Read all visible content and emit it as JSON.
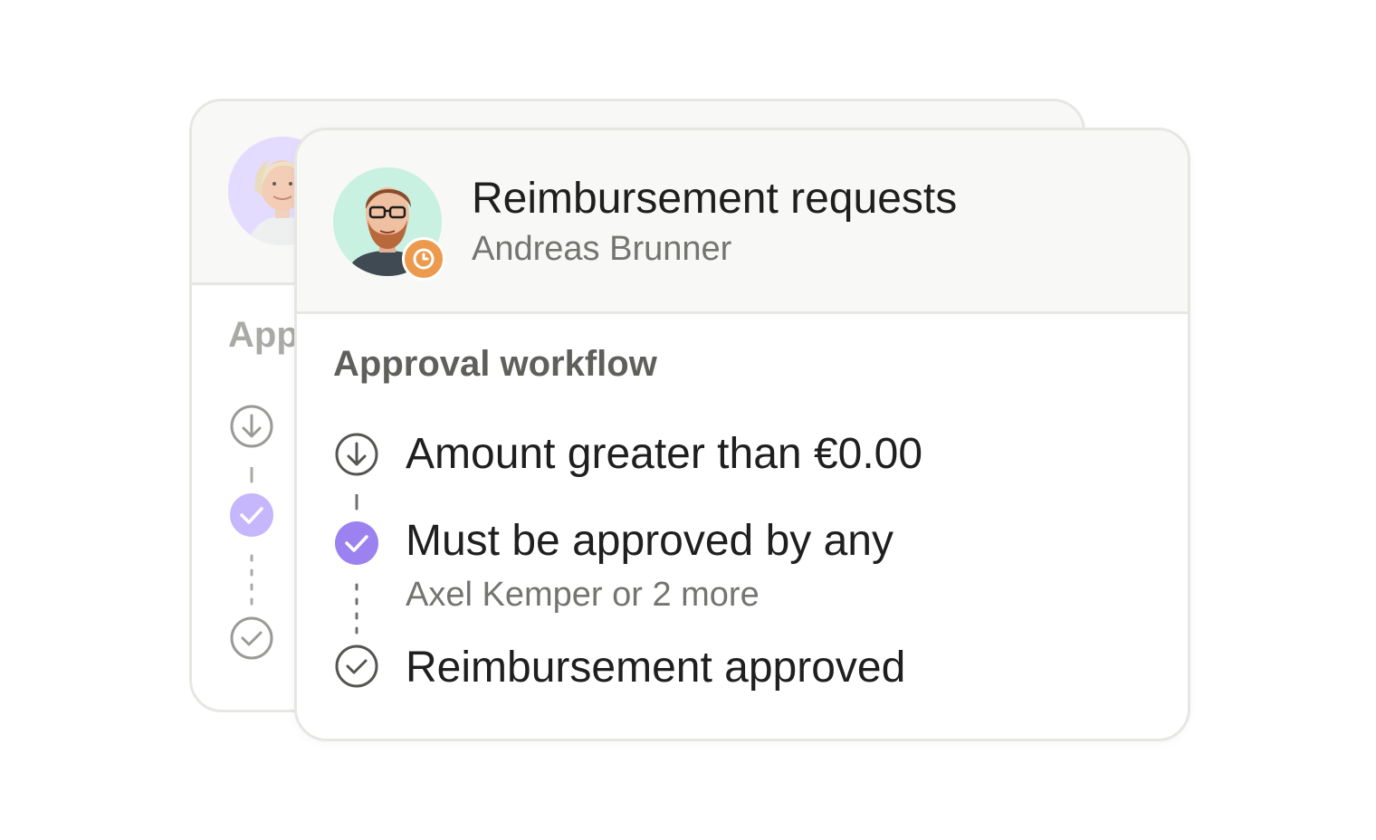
{
  "front_card": {
    "title": "Reimbursement requests",
    "requester": "Andreas Brunner",
    "section_title": "Approval workflow",
    "steps": [
      {
        "icon": "arrow-down-circle-icon",
        "text": "Amount greater than €0.00"
      },
      {
        "icon": "check-filled-circle-icon",
        "text": "Must be approved by any",
        "sub": "Axel Kemper or 2 more"
      },
      {
        "icon": "check-circle-icon",
        "text": "Reimbursement approved"
      }
    ],
    "status_icon": "clock-icon"
  },
  "back_card": {
    "section_title_visible": "App"
  },
  "colors": {
    "accent_purple": "#9b82f0",
    "accent_purple_light": "#c6b6fb",
    "status_orange": "#ec9a4e",
    "avatar_bg_green": "#c9f1e2",
    "avatar_bg_purple": "#e4dcff",
    "header_bg": "#f8f8f6",
    "border": "#e6e6e3"
  }
}
